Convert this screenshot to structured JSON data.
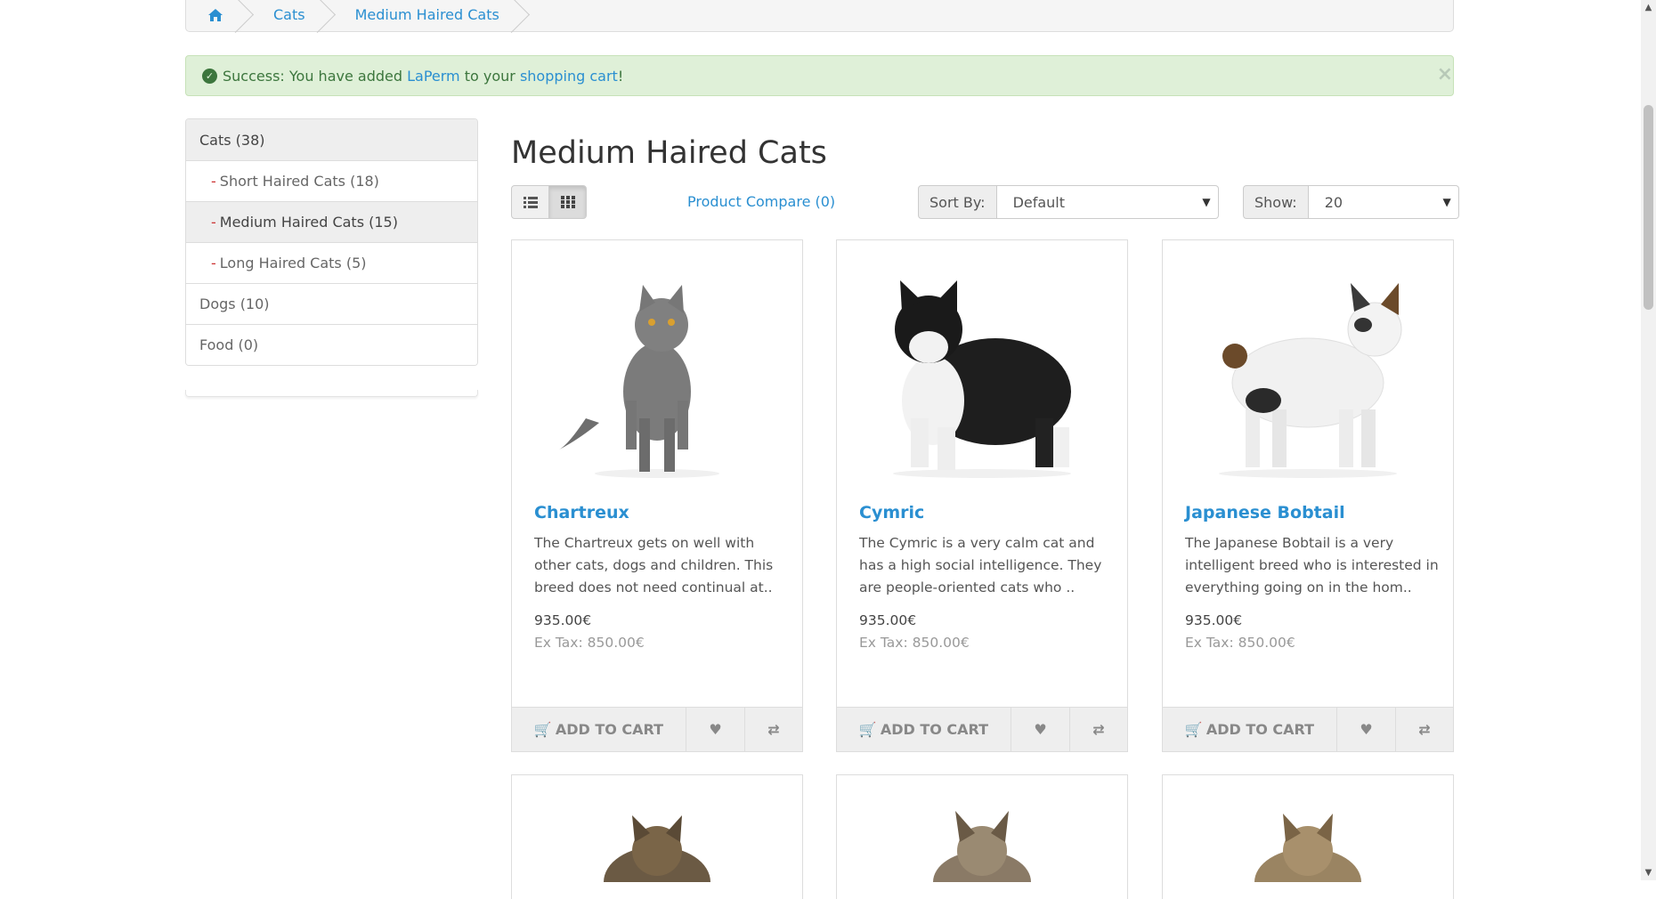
{
  "breadcrumb": {
    "items": [
      {
        "icon": "home-icon"
      },
      {
        "label": "Cats"
      },
      {
        "label": "Medium Haired Cats"
      }
    ]
  },
  "alert": {
    "prefix": "Success: You have added",
    "product_link": "LaPerm",
    "middle": "to your",
    "cart_link": "shopping cart",
    "suffix": "!",
    "close": "×"
  },
  "sidebar": {
    "items": [
      {
        "label": "Cats (38)",
        "dash": ""
      },
      {
        "label": "Short Haired Cats (18)",
        "dash": "-"
      },
      {
        "label": "Medium Haired Cats (15)",
        "dash": "-"
      },
      {
        "label": "Long Haired Cats (5)",
        "dash": "-"
      },
      {
        "label": "Dogs (10)",
        "dash": ""
      },
      {
        "label": "Food (0)",
        "dash": ""
      }
    ]
  },
  "page": {
    "title": "Medium Haired Cats",
    "compare": "Product Compare (0)",
    "sort_label": "Sort By:",
    "sort_value": "Default",
    "show_label": "Show:",
    "show_value": "20"
  },
  "products": [
    {
      "name": "Chartreux",
      "desc": "The Chartreux gets on well with other cats, dogs and children. This breed does not need continual at..",
      "price": "935.00€",
      "extax": "Ex Tax: 850.00€",
      "add_to_cart": "ADD TO CART"
    },
    {
      "name": "Cymric",
      "desc": "The Cymric is a very calm cat and has a high social intelligence. They are people-oriented cats who ..",
      "price": "935.00€",
      "extax": "Ex Tax: 850.00€",
      "add_to_cart": "ADD TO CART"
    },
    {
      "name": "Japanese Bobtail",
      "desc": "The Japanese Bobtail is a very intelligent breed who is interested in everything going on in the hom..",
      "price": "935.00€",
      "extax": "Ex Tax: 850.00€",
      "add_to_cart": "ADD TO CART"
    }
  ],
  "colors": {
    "link": "#2a8fd1",
    "success_bg": "#dff0d8",
    "success_text": "#3c763d"
  }
}
